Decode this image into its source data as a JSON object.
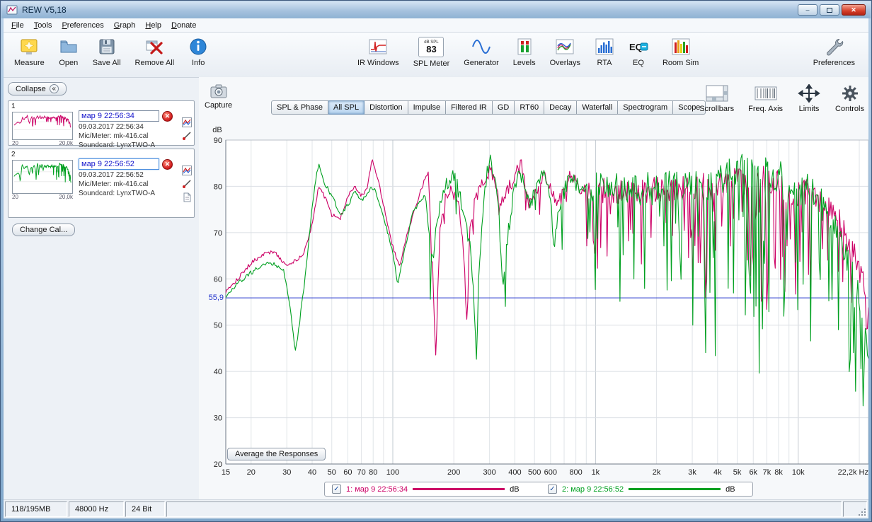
{
  "window": {
    "title": "REW V5,18"
  },
  "icons": {
    "minimize": "–",
    "close": "✕",
    "delete": "✕",
    "check": "✓",
    "collapse": "«"
  },
  "menu": {
    "items": [
      "File",
      "Tools",
      "Preferences",
      "Graph",
      "Help",
      "Donate"
    ]
  },
  "toolbar": {
    "measure": "Measure",
    "open": "Open",
    "save_all": "Save All",
    "remove_all": "Remove All",
    "info": "Info",
    "ir_windows": "IR Windows",
    "spl_meter": "SPL Meter",
    "generator": "Generator",
    "levels": "Levels",
    "overlays": "Overlays",
    "rta": "RTA",
    "eq": "EQ",
    "room_sim": "Room Sim",
    "preferences": "Preferences",
    "spl_meter_icon": {
      "top": "dB SPL",
      "value": "83"
    },
    "eq_icon_text": "EQ"
  },
  "sidebar": {
    "collapse_label": "Collapse",
    "change_cal_label": "Change Cal...",
    "measurements": [
      {
        "index": "1",
        "name": "мар 9 22:56:34",
        "date": "09.03.2017 22:56:34",
        "mic": "Mic/Meter: mk-416.cal",
        "soundcard": "Soundcard: LynxTWO-A",
        "thumb_xmin": "20",
        "thumb_xmax": "20,0k"
      },
      {
        "index": "2",
        "name": "мар 9 22:56:52",
        "date": "09.03.2017 22:56:52",
        "mic": "Mic/Meter: mk-416.cal",
        "soundcard": "Soundcard: LynxTWO-A",
        "thumb_xmin": "20",
        "thumb_xmax": "20,0k"
      }
    ]
  },
  "graph": {
    "capture_label": "Capture",
    "tabs": [
      "SPL & Phase",
      "All SPL",
      "Distortion",
      "Impulse",
      "Filtered IR",
      "GD",
      "RT60",
      "Decay",
      "Waterfall",
      "Spectrogram",
      "Scope"
    ],
    "active_tab": "All SPL",
    "buttons": {
      "scrollbars": "Scrollbars",
      "freq_axis": "Freq. Axis",
      "limits": "Limits",
      "controls": "Controls"
    },
    "average_button": "Average the Responses",
    "legend": [
      {
        "checked": true,
        "label": "1: мар 9 22:56:34",
        "unit": "dB",
        "color": "#cc0066"
      },
      {
        "checked": true,
        "label": "2: мар 9 22:56:52",
        "unit": "dB",
        "color": "#00a020"
      }
    ]
  },
  "statusbar": {
    "memory": "118/195MB",
    "sample_rate": "48000 Hz",
    "bit_depth": "24 Bit"
  },
  "chart_data": {
    "type": "line",
    "x_scale": "log",
    "x_range": [
      15,
      22200
    ],
    "y_range": [
      20,
      90
    ],
    "ylabel": "dB",
    "samples": 600,
    "grid": true,
    "cursor": {
      "value": 55.9,
      "label": "55,9",
      "color": "#2233cc"
    },
    "y_ticks": [
      {
        "v": 90,
        "label": "90"
      },
      {
        "v": 80,
        "label": "80"
      },
      {
        "v": 70,
        "label": "70"
      },
      {
        "v": 60,
        "label": "60"
      },
      {
        "v": 50,
        "label": "50"
      },
      {
        "v": 40,
        "label": "40"
      },
      {
        "v": 30,
        "label": "30"
      },
      {
        "v": 20,
        "label": "20"
      }
    ],
    "x_ticks": [
      {
        "f": 15,
        "label": "15"
      },
      {
        "f": 20,
        "label": "20"
      },
      {
        "f": 30,
        "label": "30"
      },
      {
        "f": 40,
        "label": "40"
      },
      {
        "f": 50,
        "label": "50"
      },
      {
        "f": 60,
        "label": "60"
      },
      {
        "f": 70,
        "label": "70"
      },
      {
        "f": 80,
        "label": "80"
      },
      {
        "f": 100,
        "label": "100"
      },
      {
        "f": 200,
        "label": "200"
      },
      {
        "f": 300,
        "label": "300"
      },
      {
        "f": 400,
        "label": "400"
      },
      {
        "f": 500,
        "label": "500"
      },
      {
        "f": 600,
        "label": "600"
      },
      {
        "f": 800,
        "label": "800"
      },
      {
        "f": 1000,
        "label": "1k"
      },
      {
        "f": 2000,
        "label": "2k"
      },
      {
        "f": 3000,
        "label": "3k"
      },
      {
        "f": 4000,
        "label": "4k"
      },
      {
        "f": 5000,
        "label": "5k"
      },
      {
        "f": 6000,
        "label": "6k"
      },
      {
        "f": 7000,
        "label": "7k"
      },
      {
        "f": 8000,
        "label": "8k"
      },
      {
        "f": 10000,
        "label": "10k"
      },
      {
        "f": 22200,
        "label": "22,2k Hz"
      }
    ],
    "x_gridlines": [
      20,
      30,
      40,
      50,
      60,
      70,
      80,
      90,
      100,
      200,
      300,
      400,
      500,
      600,
      700,
      800,
      900,
      1000,
      2000,
      3000,
      4000,
      5000,
      6000,
      7000,
      8000,
      9000,
      10000,
      20000
    ],
    "noise_bands": [
      {
        "fmax": 150,
        "jitter": 0.5,
        "notch_prob": 0.0,
        "notch_depth": [
          0,
          0
        ]
      },
      {
        "fmax": 900,
        "jitter": 1.6,
        "notch_prob": 0.03,
        "notch_depth": [
          3,
          9
        ]
      },
      {
        "fmax": 3000,
        "jitter": 3.0,
        "notch_prob": 0.18,
        "notch_depth": [
          4,
          22
        ]
      },
      {
        "fmax": 12000,
        "jitter": 3.6,
        "notch_prob": 0.28,
        "notch_depth": [
          5,
          34
        ]
      },
      {
        "fmax": 22200,
        "jitter": 3.2,
        "notch_prob": 0.2,
        "notch_depth": [
          4,
          18
        ]
      }
    ],
    "series": [
      {
        "name": "мар 9 22:56:34",
        "color": "#cc0066",
        "seed": 101,
        "jitter_scale": 0.95,
        "notch_scale": 0.8,
        "control_points": [
          [
            15,
            57.5
          ],
          [
            17,
            60
          ],
          [
            20,
            63.5
          ],
          [
            23,
            65.5
          ],
          [
            26,
            66
          ],
          [
            30,
            63
          ],
          [
            33,
            64
          ],
          [
            36,
            65
          ],
          [
            40,
            72
          ],
          [
            43,
            80
          ],
          [
            46,
            78
          ],
          [
            50,
            74
          ],
          [
            55,
            73
          ],
          [
            60,
            78
          ],
          [
            65,
            80
          ],
          [
            70,
            78
          ],
          [
            75,
            80
          ],
          [
            79,
            86
          ],
          [
            83,
            83
          ],
          [
            90,
            76
          ],
          [
            100,
            67
          ],
          [
            108,
            63
          ],
          [
            118,
            70
          ],
          [
            130,
            76
          ],
          [
            142,
            81
          ],
          [
            150,
            83
          ],
          [
            158,
            60
          ],
          [
            163,
            42
          ],
          [
            170,
            70
          ],
          [
            180,
            78
          ],
          [
            195,
            80
          ],
          [
            210,
            77
          ],
          [
            225,
            65
          ],
          [
            232,
            50
          ],
          [
            240,
            72
          ],
          [
            255,
            78
          ],
          [
            270,
            80
          ],
          [
            285,
            82
          ],
          [
            300,
            84
          ],
          [
            320,
            81
          ],
          [
            340,
            77
          ],
          [
            360,
            79
          ],
          [
            385,
            81
          ],
          [
            410,
            84
          ],
          [
            430,
            85
          ],
          [
            450,
            80
          ],
          [
            470,
            76
          ],
          [
            500,
            78
          ],
          [
            530,
            81
          ],
          [
            560,
            83
          ],
          [
            600,
            80
          ],
          [
            640,
            76
          ],
          [
            680,
            78
          ],
          [
            720,
            81
          ],
          [
            760,
            83
          ],
          [
            800,
            81
          ],
          [
            850,
            79
          ],
          [
            900,
            80
          ],
          [
            1000,
            80
          ],
          [
            1500,
            79
          ],
          [
            2000,
            80
          ],
          [
            3000,
            80
          ],
          [
            4000,
            81
          ],
          [
            5000,
            82
          ],
          [
            6000,
            83
          ],
          [
            7000,
            82
          ],
          [
            8000,
            82
          ],
          [
            9000,
            80
          ],
          [
            10000,
            80
          ],
          [
            12000,
            78
          ],
          [
            14000,
            76
          ],
          [
            16000,
            73
          ],
          [
            18000,
            68
          ],
          [
            20000,
            63
          ],
          [
            22200,
            57
          ]
        ]
      },
      {
        "name": "мар 9 22:56:52",
        "color": "#00a020",
        "seed": 202,
        "jitter_scale": 1.05,
        "notch_scale": 1.2,
        "control_points": [
          [
            15,
            56.5
          ],
          [
            17,
            59
          ],
          [
            20,
            61.5
          ],
          [
            23,
            63
          ],
          [
            26,
            63.5
          ],
          [
            29,
            62
          ],
          [
            31,
            55
          ],
          [
            33,
            44
          ],
          [
            35,
            52
          ],
          [
            38,
            65
          ],
          [
            40,
            76
          ],
          [
            43,
            85
          ],
          [
            46,
            81
          ],
          [
            50,
            78
          ],
          [
            55,
            74
          ],
          [
            60,
            76
          ],
          [
            65,
            79
          ],
          [
            70,
            77
          ],
          [
            75,
            79
          ],
          [
            80,
            80
          ],
          [
            85,
            77
          ],
          [
            92,
            72
          ],
          [
            100,
            66
          ],
          [
            106,
            59
          ],
          [
            115,
            67
          ],
          [
            125,
            74
          ],
          [
            135,
            77
          ],
          [
            145,
            78
          ],
          [
            152,
            68
          ],
          [
            158,
            63
          ],
          [
            165,
            73
          ],
          [
            175,
            79
          ],
          [
            190,
            82
          ],
          [
            200,
            83
          ],
          [
            212,
            79
          ],
          [
            225,
            74
          ],
          [
            240,
            68
          ],
          [
            252,
            55
          ],
          [
            258,
            42
          ],
          [
            265,
            60
          ],
          [
            275,
            72
          ],
          [
            290,
            83
          ],
          [
            305,
            86
          ],
          [
            320,
            82
          ],
          [
            335,
            74
          ],
          [
            348,
            57
          ],
          [
            360,
            65
          ],
          [
            375,
            72
          ],
          [
            395,
            79
          ],
          [
            415,
            82
          ],
          [
            435,
            83
          ],
          [
            455,
            79
          ],
          [
            480,
            77
          ],
          [
            510,
            80
          ],
          [
            540,
            84
          ],
          [
            570,
            82
          ],
          [
            600,
            78
          ],
          [
            620,
            67
          ],
          [
            645,
            73
          ],
          [
            675,
            77
          ],
          [
            710,
            80
          ],
          [
            750,
            83
          ],
          [
            800,
            81
          ],
          [
            860,
            79
          ],
          [
            920,
            80
          ],
          [
            1000,
            81
          ],
          [
            1500,
            80
          ],
          [
            2000,
            81
          ],
          [
            3000,
            81
          ],
          [
            4000,
            82
          ],
          [
            5000,
            84
          ],
          [
            6000,
            85
          ],
          [
            7000,
            84
          ],
          [
            8000,
            83
          ],
          [
            9000,
            82
          ],
          [
            10000,
            81
          ],
          [
            12000,
            79
          ],
          [
            14000,
            75
          ],
          [
            16000,
            70
          ],
          [
            18000,
            64
          ],
          [
            20000,
            57
          ],
          [
            22200,
            45
          ]
        ]
      }
    ]
  }
}
